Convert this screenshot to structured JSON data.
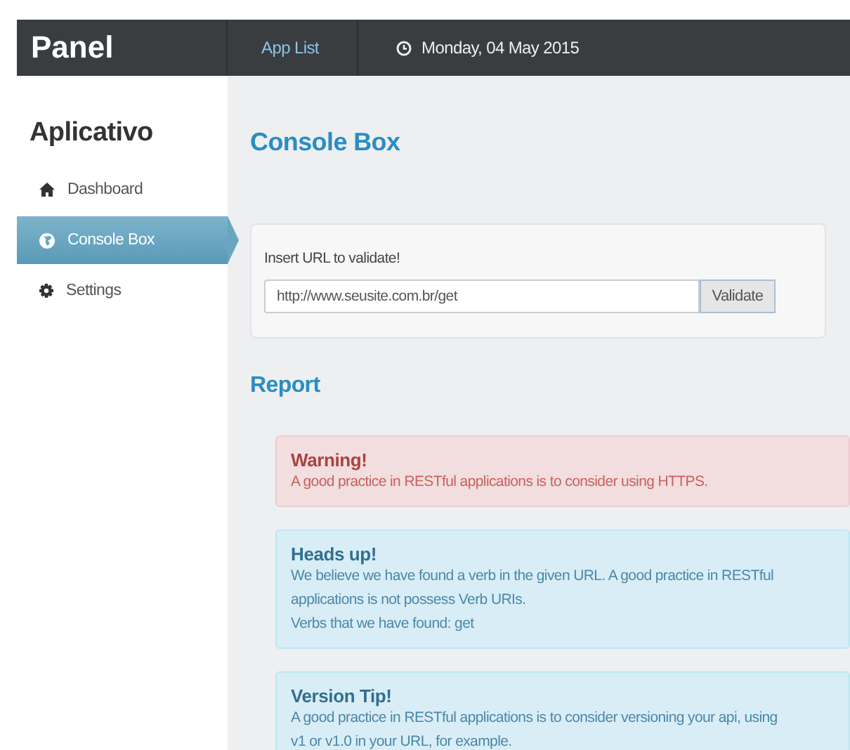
{
  "topbar": {
    "brand": "Panel",
    "nav_link": "App List",
    "date": "Monday, 04 May 2015"
  },
  "sidebar": {
    "title": "Aplicativo",
    "items": [
      {
        "label": "Dashboard",
        "kind": "home",
        "selected": false
      },
      {
        "label": "Console Box",
        "kind": "globe",
        "selected": true
      },
      {
        "label": "Settings",
        "kind": "gear",
        "selected": false
      }
    ]
  },
  "console": {
    "heading": "Console Box",
    "label": "Insert URL to validate!",
    "url": "http://www.seusite.com.br/get",
    "button": "Validate"
  },
  "report": {
    "heading": "Report",
    "alerts": [
      {
        "kind": "danger",
        "title": "Warning!",
        "lines": [
          "A good practice in RESTful applications is to consider using HTTPS."
        ]
      },
      {
        "kind": "info",
        "title": "Heads up!",
        "lines": [
          "We believe we have found a verb in the given URL. A good practice in RESTful applications is not possess Verb URIs.",
          "Verbs that we have found: get"
        ]
      },
      {
        "kind": "info",
        "title": "Version Tip!",
        "lines": [
          "A good practice in RESTful applications is to consider versioning your api, using v1 or v1.0 in your URL, for example."
        ]
      }
    ]
  }
}
